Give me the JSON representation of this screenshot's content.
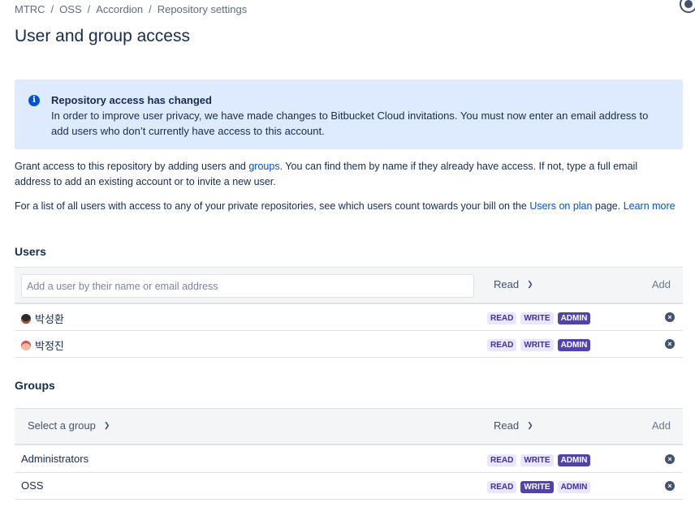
{
  "breadcrumb": [
    "MTRC",
    "OSS",
    "Accordion",
    "Repository settings"
  ],
  "page_title": "User and group access",
  "banner": {
    "title": "Repository access has changed",
    "text": "In order to improve user privacy, we have made changes to Bitbucket Cloud invitations. You must now enter an email address to add users who don’t currently have access to this account."
  },
  "intro": {
    "p1_before": "Grant access to this repository by adding users and ",
    "p1_link": "groups",
    "p1_after": ". You can find them by name if they already have access. If not, type a full email address to add an existing account or to invite a new user.",
    "p2_before": "For a list of all users with access to any of your private repositories, see which users count towards your bill on the ",
    "p2_link": "Users on plan",
    "p2_middle": " page. ",
    "p2_link2": "Learn more"
  },
  "users": {
    "title": "Users",
    "input_placeholder": "Add a user by their name or email address",
    "permission": "Read",
    "add_label": "Add",
    "rows": [
      {
        "name": "박성환",
        "read": "READ",
        "write": "WRITE",
        "admin": "ADMIN",
        "active": "admin"
      },
      {
        "name": "박정진",
        "read": "READ",
        "write": "WRITE",
        "admin": "ADMIN",
        "active": "admin"
      }
    ]
  },
  "groups": {
    "title": "Groups",
    "select_label": "Select a group",
    "permission": "Read",
    "add_label": "Add",
    "rows": [
      {
        "name": "Administrators",
        "read": "READ",
        "write": "WRITE",
        "admin": "ADMIN",
        "active": "admin"
      },
      {
        "name": "OSS",
        "read": "READ",
        "write": "WRITE",
        "admin": "ADMIN",
        "active": "write"
      }
    ]
  }
}
